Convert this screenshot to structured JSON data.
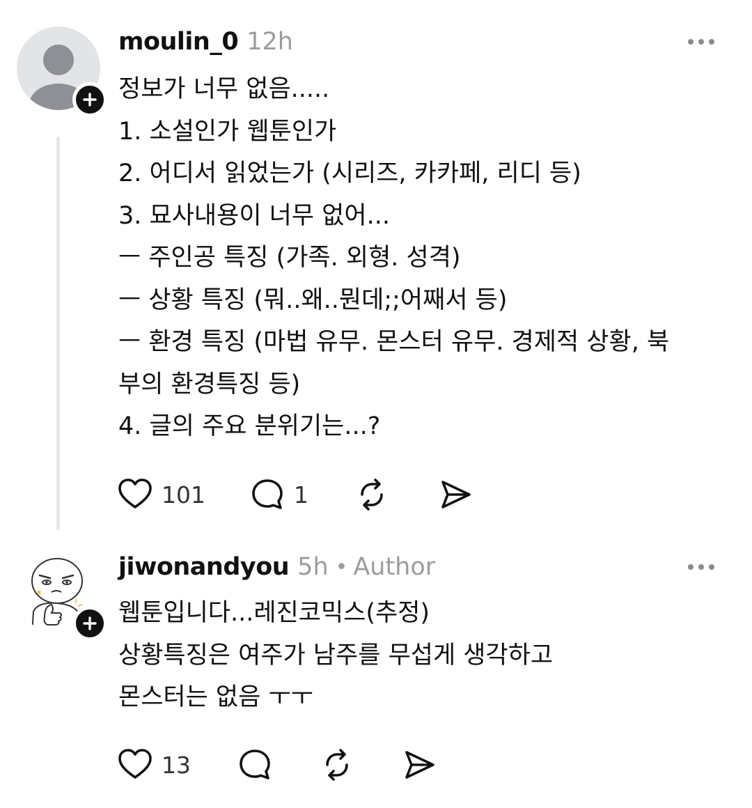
{
  "posts": [
    {
      "username": "moulin_0",
      "time": "12h",
      "lines": [
        "정보가 너무 없음.....",
        "1. 소설인가 웹툰인가",
        "2. 어디서 읽었는가 (시리즈, 카카페, 리디 등)",
        "3. 묘사내용이 너무 없어...",
        "ㅡ 주인공 특징 (가족. 외형. 성격)",
        "ㅡ 상황 특징 (뭐..왜..뭔데;;어째서 등)",
        "ㅡ 환경 특징 (마법 유무. 몬스터 유무. 경제적 상황, 북",
        "부의 환경특징 등)",
        "4. 글의 주요 분위기는...?"
      ],
      "likes": "101",
      "comments": "1",
      "avatar_icon": "default-person-avatar"
    },
    {
      "username": "jiwonandyou",
      "time": "5h",
      "separator": "•",
      "role": "Author",
      "lines": [
        "웹툰입니다...레진코믹스(추정)",
        "상황특징은 여주가 남주를 무섭게 생각하고",
        "몬스터는 없음 ㅜㅜ"
      ],
      "likes": "13",
      "avatar_icon": "cartoon-thumbs-up-avatar"
    }
  ],
  "icons": {
    "like": "heart-icon",
    "comment": "comment-bubble-icon",
    "repost": "repost-icon",
    "share": "share-send-icon",
    "more": "more-dots-icon",
    "follow": "plus-icon"
  },
  "colors": {
    "text": "#111111",
    "muted": "#9c9c9c",
    "thread_line": "#e6e6e6",
    "avatar_bg": "#e3e4e6"
  }
}
